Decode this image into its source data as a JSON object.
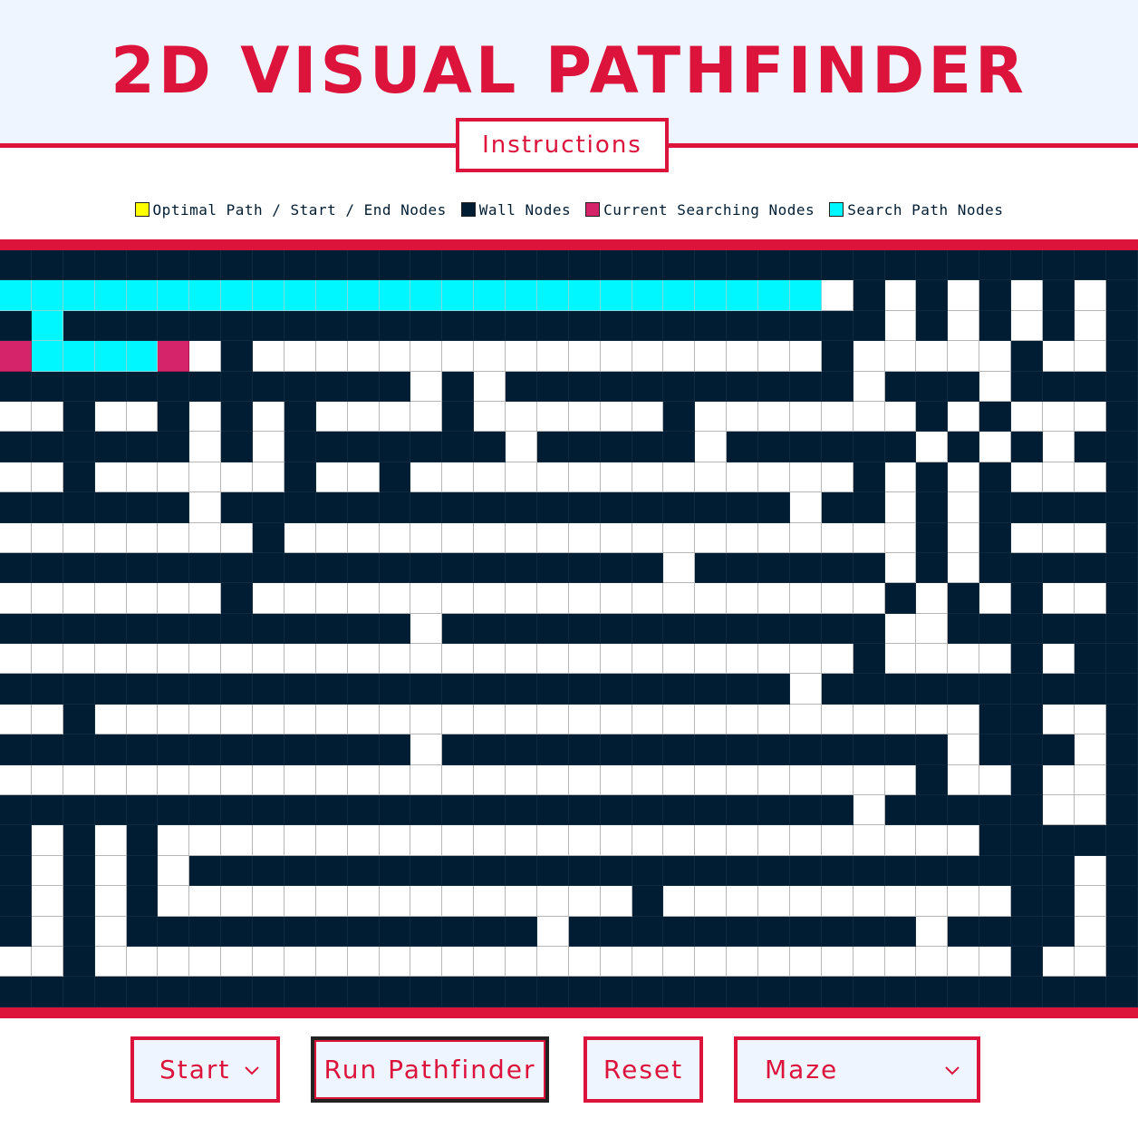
{
  "header": {
    "title": "2D VISUAL PATHFINDER",
    "instructions_label": "Instructions"
  },
  "legend": [
    {
      "label": "Optimal Path / Start / End Nodes",
      "color": "#ffff00"
    },
    {
      "label": "Wall Nodes",
      "color": "#001d33"
    },
    {
      "label": "Current Searching Nodes",
      "color": "#d6246a"
    },
    {
      "label": "Search Path Nodes",
      "color": "#00f7ff"
    }
  ],
  "colors": {
    "accent": "#dc143c",
    "wall": "#001d33",
    "open": "#ffffff",
    "search": "#00f7ff",
    "current": "#d6246a",
    "optimal": "#ffff00"
  },
  "maze": {
    "legend_key": "w = wall, o = open, s = search path node, c = current searching node",
    "rows": [
      "wwwwwwwwwwwwwwwwwwwwwwwwwwwwwwwwwwww",
      "ssssssssssssssssssssssssssowowowowow",
      "wswwwwwwwwwwwwwwwwwwwwwwwwwwowowowow",
      "csssscowoooooooooooooooooowooooowoo",
      "wwwwwwwwwwwwwowowwwwwwwwwwwowwwowwww",
      "oowoowowowoooowoooooowooooooowowooo",
      "wwwwwwowowwwwwwwowwwwwowwwwwwowowow",
      "oowoooooowoowoooooooooooooowowowooo",
      "wwwwwwowwwwwwwwwwwwwwwwwwowwowowwww",
      "oooooooowoooooooooooooooooooowowooo",
      "wwwwwwwwwwwwwwwwwwwwwowwwwwwowowwww",
      "ooooooowoooooooooooooooooooowowowoo",
      "wwwwwwwwwwwwwowwwwwwwwwwwwwwoowwwww",
      "ooooooooooooooooooooooooooowoooowow",
      "wwwwwwwwwwwwwwwwwwwwwwwwwowwwwwwwww",
      "oowoooooooooooooooooooooooooooowwoo",
      "wwwwwwwwwwwwwowwwwwwwwwwwwwwwwowwwo",
      "ooooooooooooooooooooooooooooowoowoo",
      "wwwwwwwwwwwwwwwwwwwwwwwwwwwowwwwwoo",
      "wowowoooooooooooooooooooooooooowwww",
      "wowowowwwwwwwwwwwwwwwwwwwwwwwwwwwwo",
      "wowowooooooooooooooowooooooooooowwo",
      "wowowwwwwwwwwwwwwowwwwwwwwwwwowwwwo",
      "oowooooooooooooooooooooooooooooowoo",
      "wwwwwwwwwwwwwwwwwwwwwwwwwwwwwwwwwww"
    ]
  },
  "controls": {
    "start_select": "Start",
    "run_button": "Run Pathfinder",
    "reset_button": "Reset",
    "maze_select": "Maze"
  }
}
